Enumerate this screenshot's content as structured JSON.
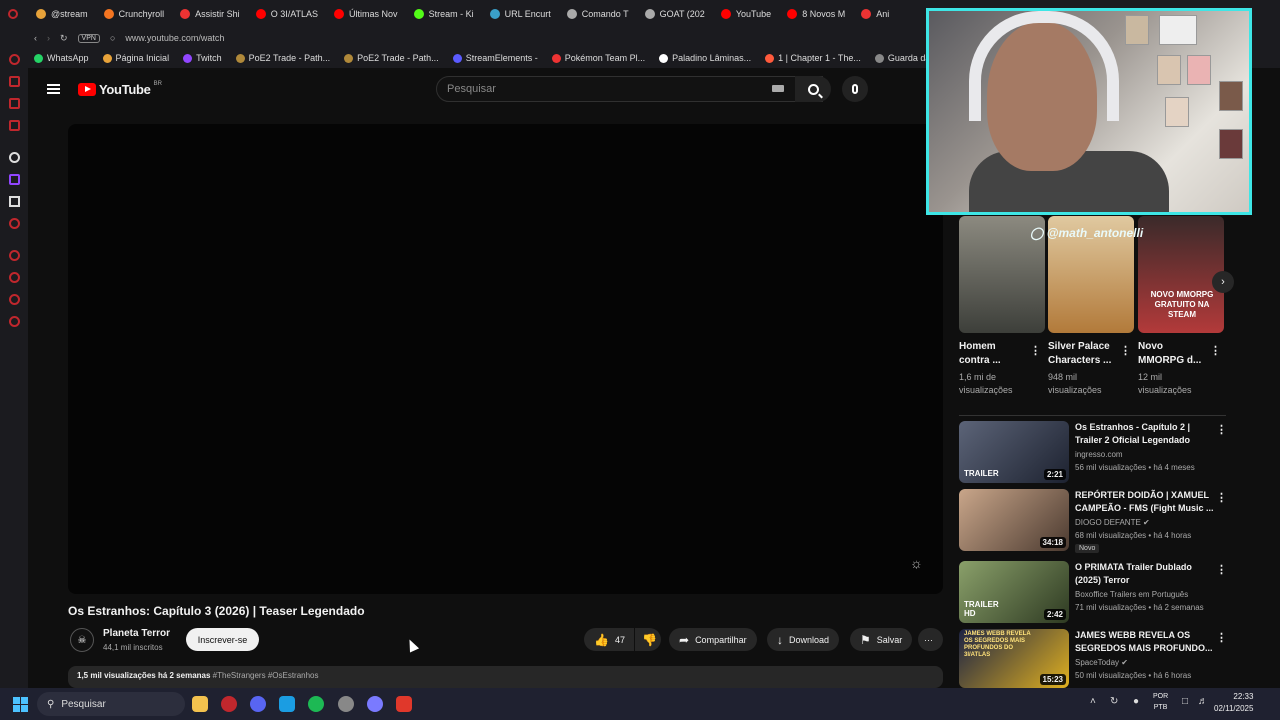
{
  "browser": {
    "tabs": [
      "@stream",
      "Crunchyroll",
      "Assistir Shi",
      "O 3I/ATLAS",
      "Últimas Nov",
      "Stream - Ki",
      "URL Encurt",
      "Comando T",
      "GOAT (202",
      "YouTube",
      "8 Novos M",
      "Ani"
    ],
    "url": "www.youtube.com/watch",
    "vpn_label": "VPN",
    "bookmarks": [
      "WhatsApp",
      "Página Inicial",
      "Twitch",
      "PoE2 Trade - Path...",
      "PoE2 Trade - Path...",
      "StreamElements -",
      "Pokémon Team Pl...",
      "Paladino Lâminas...",
      "1 | Chapter 1 - The...",
      "Guarda da forja, ní..."
    ],
    "bookmark_colors": [
      "#25d366",
      "#e8a33a",
      "#9146ff",
      "#b0893a",
      "#b0893a",
      "#5b5bff",
      "#e33",
      "#ffffff",
      "#ff5a3c",
      "#888888"
    ]
  },
  "youtube": {
    "logo_word": "YouTube",
    "country": "BR",
    "search_placeholder": "Pesquisar"
  },
  "video": {
    "title": "Os Estranhos: Capítulo 3 (2026) | Teaser Legendado",
    "channel": "Planeta Terror",
    "subscribers": "44,1 mil inscritos",
    "subscribe_label": "Inscrever-se",
    "likes": "47",
    "share_label": "Compartilhar",
    "download_label": "Download",
    "save_label": "Salvar",
    "views": "1,5 mil visualizações",
    "age": "há 2 semanas",
    "tags": "#TheStrangers #OsEstranhos"
  },
  "webcam": {
    "handle": "@math_antonelli"
  },
  "shorts": [
    {
      "title1": "Homem",
      "title2": "contra ...",
      "meta1": "1,6 mi de",
      "meta2": "visualizações",
      "color": "#5b5e55"
    },
    {
      "title1": "Silver Palace",
      "title2": "Characters ...",
      "meta1": "948 mil",
      "meta2": "visualizações",
      "color": "#c9a46d"
    },
    {
      "title1": "Novo",
      "title2": "MMORPG d...",
      "meta1": "12 mil",
      "meta2": "visualizações",
      "color": "#a33a3a",
      "overlay": "NOVO MMORPG GRATUITO NA STEAM"
    }
  ],
  "related": [
    {
      "title1": "Os Estranhos - Capítulo 2 |",
      "title2": "Trailer 2 Oficial Legendado",
      "channel": "ingresso.com",
      "meta": "56 mil visualizações • há 4 meses",
      "duration": "2:21",
      "label": "TRAILER",
      "color": "#2c3342"
    },
    {
      "title1": "REPÓRTER DOIDÃO | XAMUEL",
      "title2": "CAMPEÃO - FMS (Fight Music ...",
      "channel": "DIOGO DEFANTE",
      "meta": "68 mil visualizações • há 4 horas",
      "duration": "34:18",
      "badge": "Novo",
      "color": "#6d5a4c"
    },
    {
      "title1": "O PRIMATA Trailer Dublado",
      "title2": "(2025) Terror",
      "channel": "Boxoffice Trailers em Português",
      "meta": "71 mil visualizações • há 2 semanas",
      "duration": "2:42",
      "label": "TRAILER HD",
      "color": "#4b5a3a"
    },
    {
      "title1": "JAMES WEBB REVELA OS",
      "title2": "SEGREDOS MAIS PROFUNDO...",
      "channel": "SpaceToday",
      "meta": "50 mil visualizações • há 6 horas",
      "duration": "15:23",
      "label": "JAMES WEBB REVELA OS SEGREDOS MAIS PROFUNDOS DO 3I/ATLAS",
      "color": "#2a2f4a"
    }
  ],
  "taskbar": {
    "search_label": "Pesquisar",
    "lang1": "POR",
    "lang2": "PTB",
    "time": "22:33",
    "date": "02/11/2025",
    "app_colors": [
      "#f2c14e",
      "#c0272d",
      "#5865f2",
      "#1b9de2",
      "#1db954",
      "#888888",
      "#7a7aff",
      "#e0382b"
    ]
  }
}
